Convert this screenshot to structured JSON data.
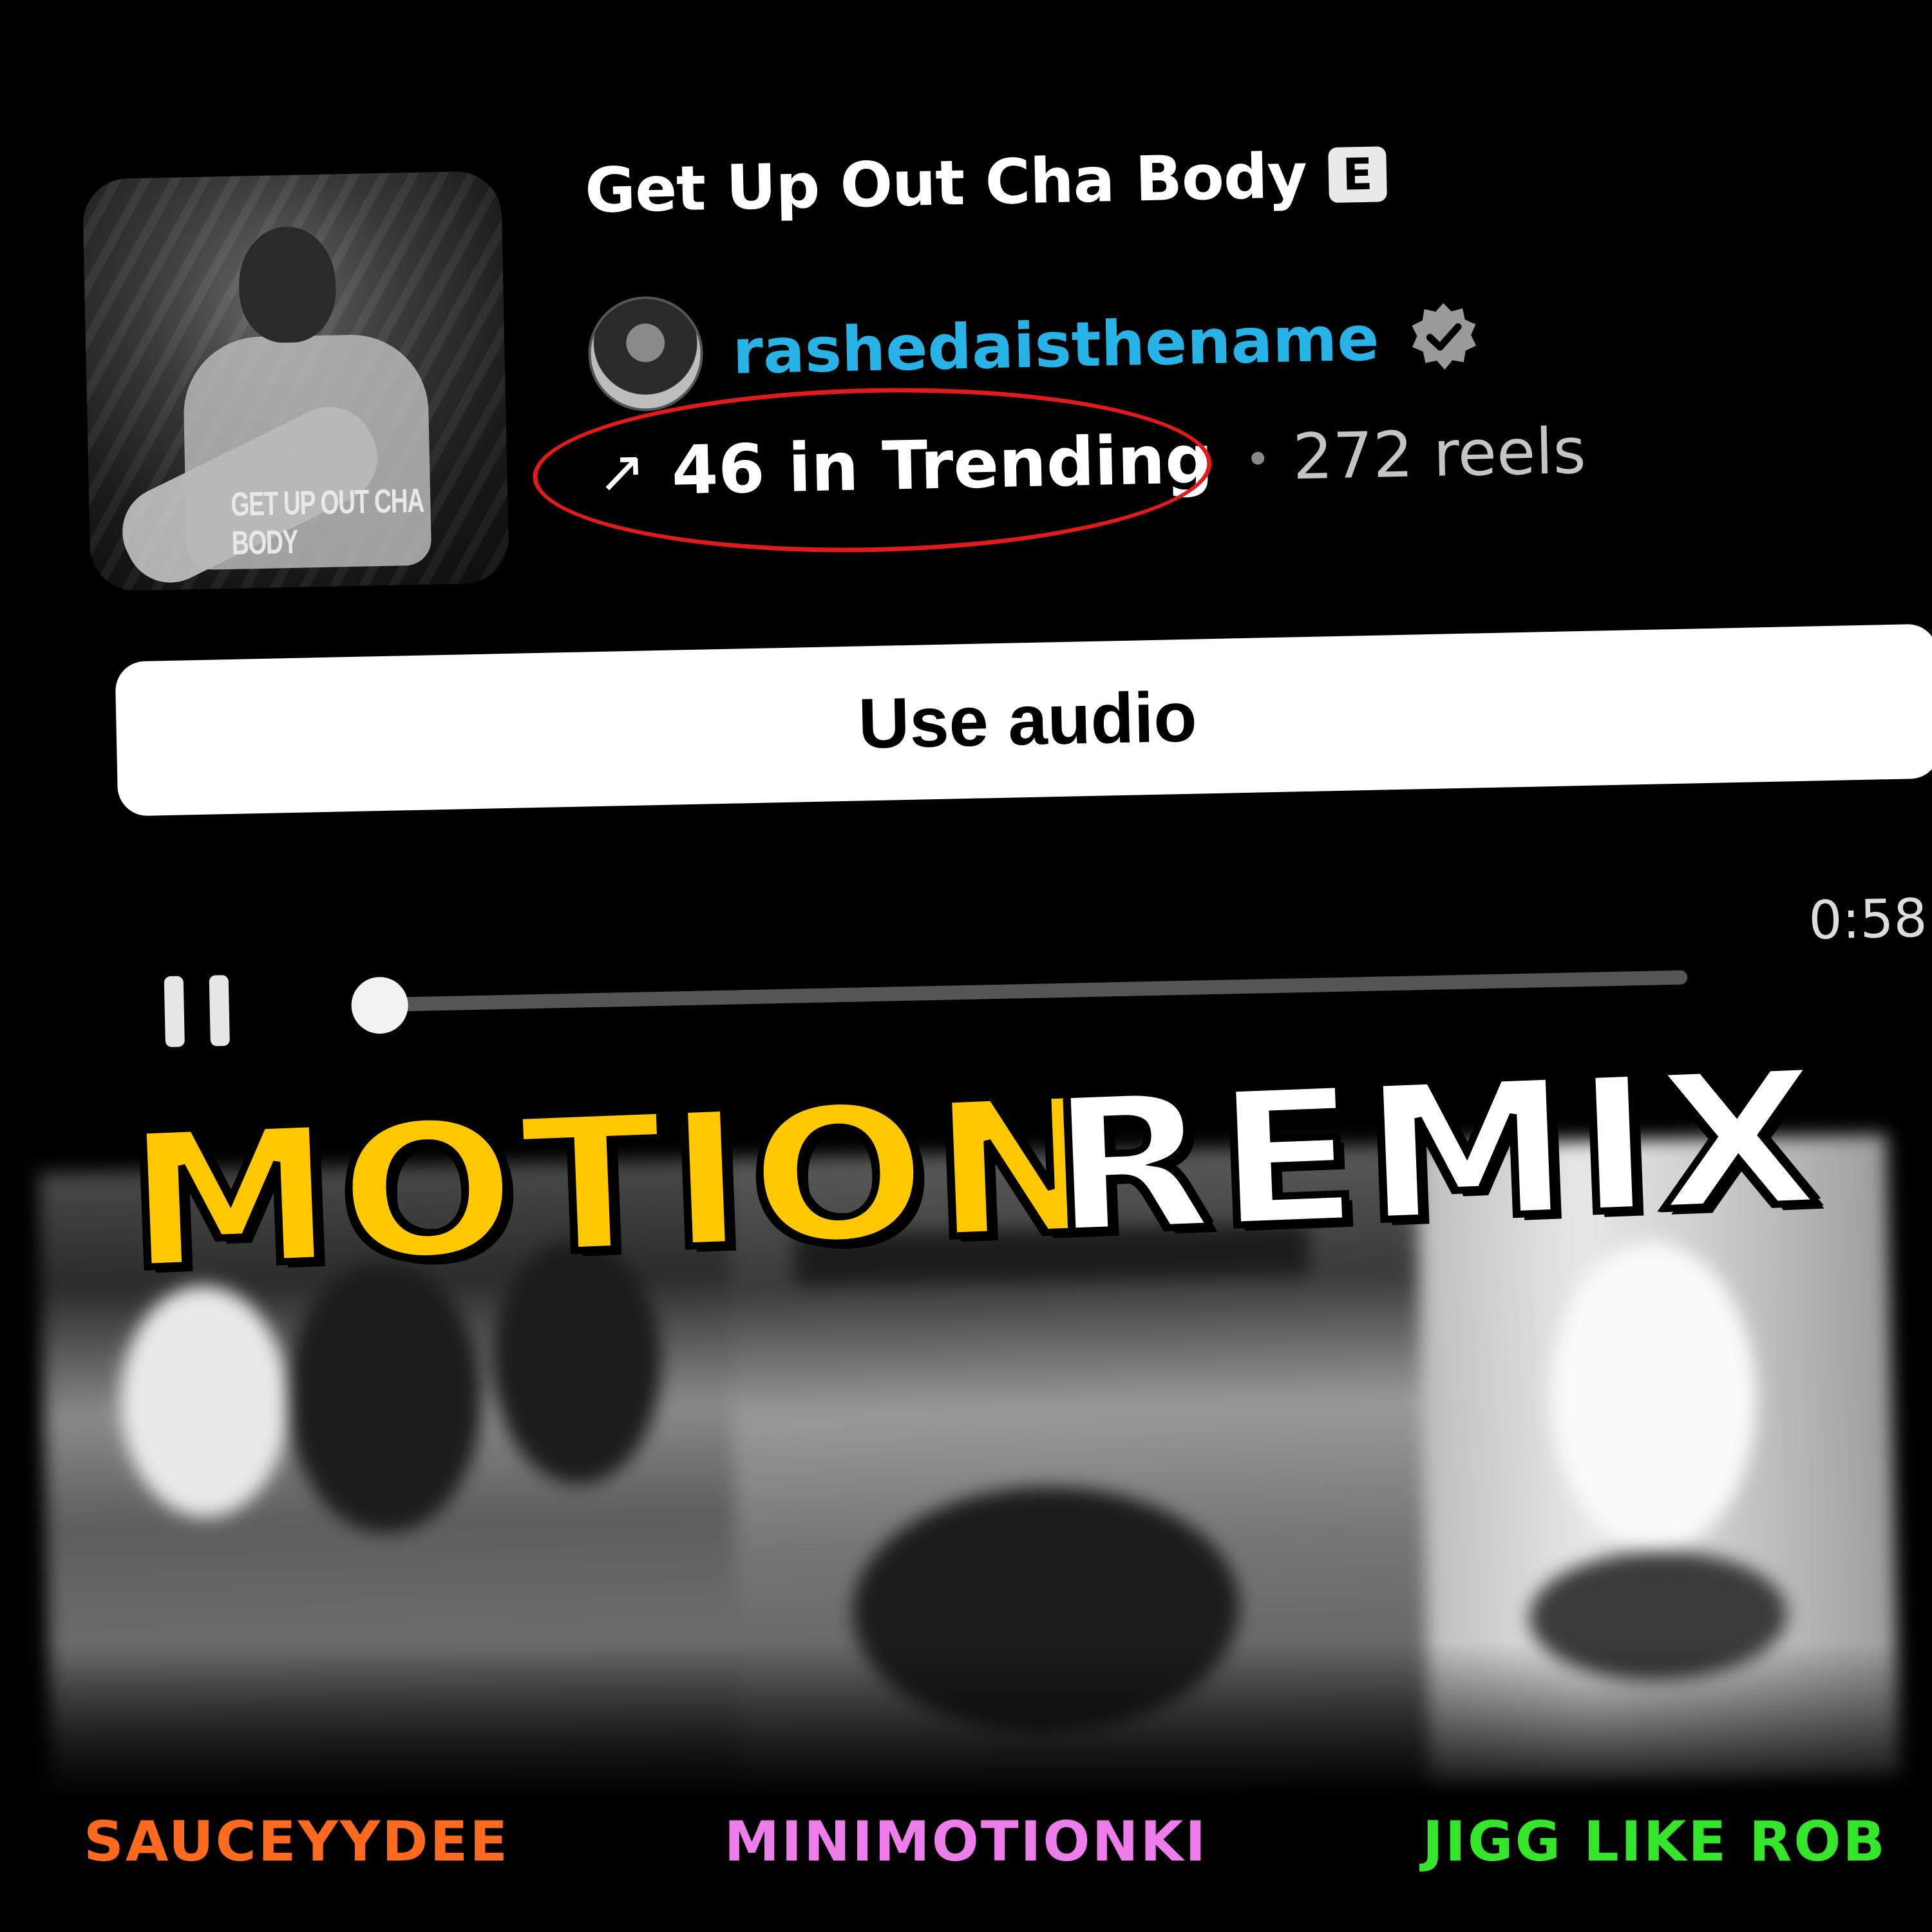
{
  "song": {
    "title": "Get Up Out Cha Body",
    "explicit_badge": "E",
    "cover_text": "GET UP OUT CHA BODY"
  },
  "artist": {
    "handle": "rashedaisthename",
    "verified_icon": "verified-badge-icon",
    "color": "#27b3e6"
  },
  "stats": {
    "trend_arrow": "↗",
    "trending": "46 in Trending",
    "reels": "272 reels",
    "highlight_color": "#e11a1a"
  },
  "actions": {
    "use_audio": "Use audio"
  },
  "player": {
    "duration": "0:58",
    "progress_fraction": 0.0,
    "pause_icon": "pause-icon"
  },
  "headline": {
    "word1": "MOTION",
    "word2": "REMIX",
    "word1_color": "#ffc800",
    "word2_color": "#ffffff"
  },
  "credits": [
    {
      "name": "SAUCEYYDEE",
      "color": "#ff6a1f"
    },
    {
      "name": "MINIMOTIONKI",
      "color": "#ee7dec"
    },
    {
      "name": "JIGG LIKE ROB",
      "color": "#35e52a"
    }
  ]
}
